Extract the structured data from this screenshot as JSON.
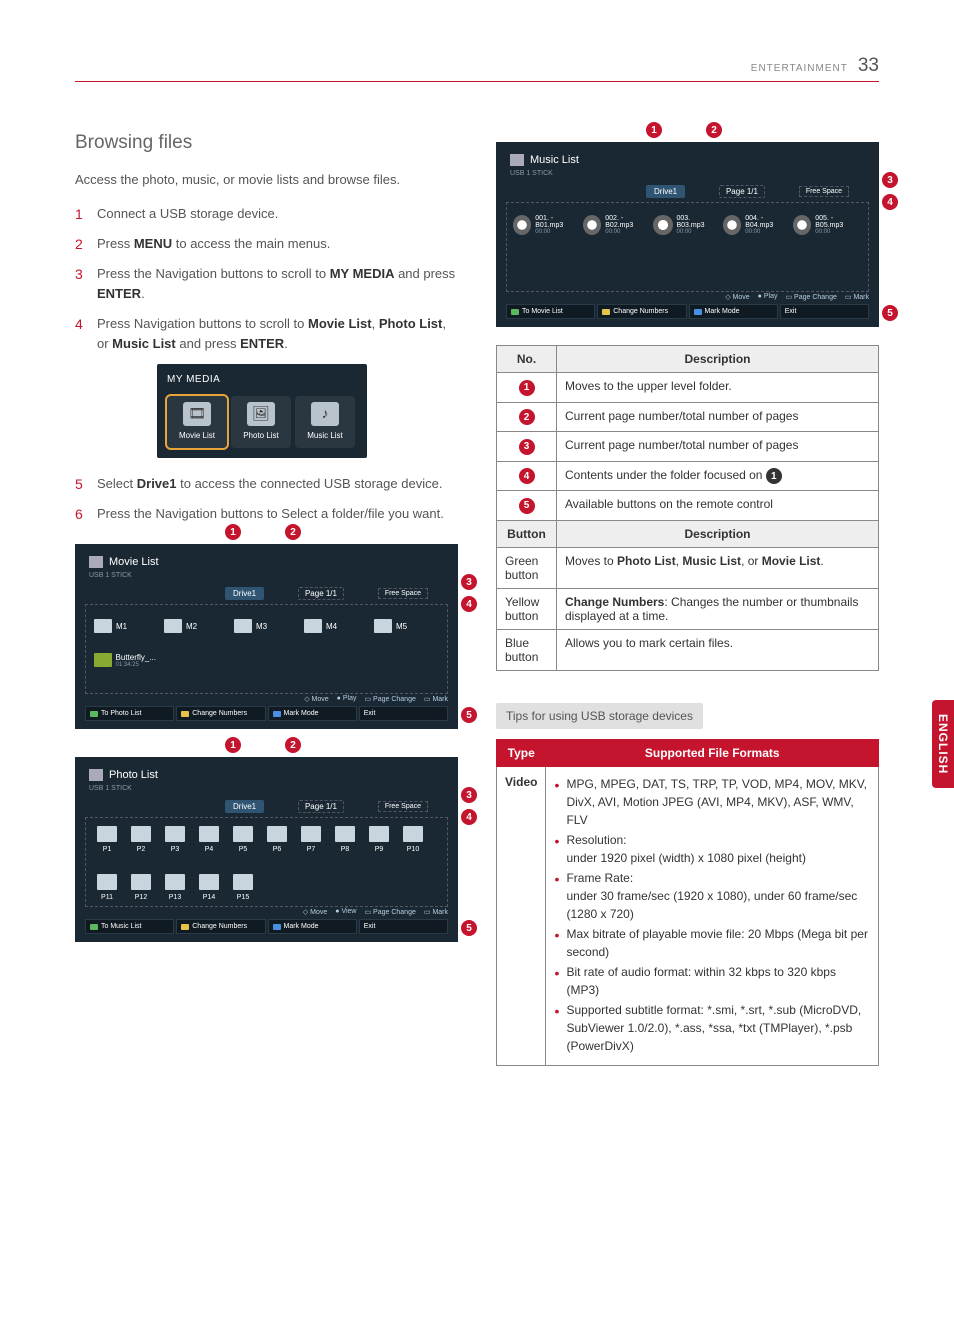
{
  "header": {
    "section": "ENTERTAINMENT",
    "page": "33"
  },
  "sideTab": "ENGLISH",
  "title": "Browsing files",
  "intro": "Access the photo, music, or movie lists and browse files.",
  "steps": {
    "s1": "Connect a USB storage device.",
    "s2a": "Press ",
    "s2b": "MENU",
    "s2c": " to access the main menus.",
    "s3a": "Press the Navigation buttons to scroll to ",
    "s3b": "MY MEDIA",
    "s3c": " and press ",
    "s3d": "ENTER",
    "s3e": ".",
    "s4a": "Press Navigation buttons to scroll to ",
    "s4b": "Movie List",
    "s4c": ", ",
    "s4d": "Photo List",
    "s4e": ", or ",
    "s4f": "Music List",
    "s4g": " and press ",
    "s4h": "ENTER",
    "s4i": ".",
    "s5a": "Select ",
    "s5b": "Drive1",
    "s5c": " to access the connected USB storage device.",
    "s6": "Press the Navigation buttons to Select a folder/file you want."
  },
  "myMedia": {
    "title": "MY MEDIA",
    "movie": "Movie List",
    "photo": "Photo List",
    "music": "Music List"
  },
  "movieList": {
    "title": "Movie List",
    "subtitle": "USB 1 STICK",
    "drive": "Drive1",
    "page": "Page 1/1",
    "free": "Free Space",
    "folders": [
      "M1",
      "M2",
      "M3",
      "M4",
      "M5"
    ],
    "movieName": "Butterfly_...",
    "movieDur": "01:34:25",
    "footer": {
      "move": "Move",
      "play": "Play",
      "pageChange": "Page Change",
      "mark": "Mark"
    },
    "buttons": {
      "b1": "To Photo List",
      "b2": "Change Numbers",
      "b3": "Mark Mode",
      "b4": "Exit"
    }
  },
  "photoList": {
    "title": "Photo List",
    "subtitle": "USB 1 STICK",
    "drive": "Drive1",
    "page": "Page 1/1",
    "free": "Free Space",
    "items": [
      "P1",
      "P2",
      "P3",
      "P4",
      "P5",
      "P6",
      "P7",
      "P8",
      "P9",
      "P10",
      "P11",
      "P12",
      "P13",
      "P14",
      "P15"
    ],
    "footer": {
      "move": "Move",
      "view": "View",
      "pageChange": "Page Change",
      "mark": "Mark"
    },
    "buttons": {
      "b1": "To Music List",
      "b2": "Change Numbers",
      "b3": "Mark Mode",
      "b4": "Exit"
    }
  },
  "musicList": {
    "title": "Music List",
    "subtitle": "USB 1 STICK",
    "drive": "Drive1",
    "page": "Page 1/1",
    "free": "Free Space",
    "tracks": [
      {
        "name": "001. - B01.mp3",
        "dur": "00:00"
      },
      {
        "name": "002. - B02.mp3",
        "dur": "00:00"
      },
      {
        "name": "003. B03.mp3",
        "dur": "00:00"
      },
      {
        "name": "004. - B04.mp3",
        "dur": "00:00"
      },
      {
        "name": "005. - B05.mp3",
        "dur": "00:00"
      }
    ],
    "footer": {
      "move": "Move",
      "play": "Play",
      "pageChange": "Page Change",
      "mark": "Mark"
    },
    "buttons": {
      "b1": "To Movie List",
      "b2": "Change Numbers",
      "b3": "Mark Mode",
      "b4": "Exit"
    }
  },
  "descTable": {
    "hNo": "No.",
    "hDesc": "Description",
    "r1": "Moves to the upper level folder.",
    "r2": "Current page number/total number of pages",
    "r3": "Current page number/total number of pages",
    "r4a": "Contents under the folder focused on ",
    "r5": "Available buttons on the remote control",
    "hBtn": "Button",
    "green": "Green button",
    "greenDesc_a": "Moves to ",
    "greenDesc_b": "Photo List",
    "greenDesc_c": ", ",
    "greenDesc_d": "Music List",
    "greenDesc_e": ", or ",
    "greenDesc_f": "Movie List",
    "greenDesc_g": ".",
    "yellow": "Yellow button",
    "yellowDesc_a": "Change Numbers",
    "yellowDesc_b": ": Changes the number or thumbnails displayed at a time.",
    "blue": "Blue button",
    "blueDesc": "Allows you to mark certain files."
  },
  "tips": {
    "header": "Tips for using USB storage devices",
    "thType": "Type",
    "thFormat": "Supported File Formats",
    "video": "Video",
    "b1": "MPG, MPEG, DAT, TS, TRP, TP, VOD, MP4, MOV, MKV, DivX, AVI, Motion JPEG (AVI, MP4, MKV), ASF, WMV, FLV",
    "b2a": "Resolution:",
    "b2b": "under 1920 pixel (width) x 1080 pixel (height)",
    "b3a": "Frame Rate:",
    "b3b": "under 30 frame/sec (1920 x 1080), under 60 frame/sec (1280 x 720)",
    "b4": "Max bitrate of playable movie file: 20 Mbps (Mega bit per second)",
    "b5": "Bit rate of audio format: within 32 kbps to 320 kbps (MP3)",
    "b6": "Supported subtitle format: *.smi, *.srt, *.sub (MicroDVD, SubViewer 1.0/2.0), *.ass, *ssa, *txt (TMPlayer), *.psb (PowerDivX)"
  },
  "nums": {
    "n1": "1",
    "n2": "2",
    "n3": "3",
    "n4": "4",
    "n5": "5"
  }
}
